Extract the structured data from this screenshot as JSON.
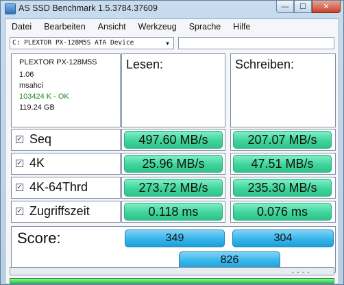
{
  "window": {
    "title": "AS SSD Benchmark 1.5.3784.37609",
    "minimize": "—",
    "maximize": "☐",
    "close": "✕"
  },
  "menu": [
    "Datei",
    "Bearbeiten",
    "Ansicht",
    "Werkzeug",
    "Sprache",
    "Hilfe"
  ],
  "device": {
    "selected": "C: PLEXTOR PX-128M5S ATA Device",
    "arrow": "▼"
  },
  "drive_info": {
    "model": "PLEXTOR PX-128M5S",
    "firmware": "1.06",
    "driver": "msahci",
    "alignment": "103424 K - OK",
    "size": "119.24 GB"
  },
  "headers": {
    "read": "Lesen:",
    "write": "Schreiben:"
  },
  "tests": [
    {
      "label": "Seq",
      "checked": "✓",
      "read": "497.60 MB/s",
      "write": "207.07 MB/s"
    },
    {
      "label": "4K",
      "checked": "✓",
      "read": "25.96 MB/s",
      "write": "47.51 MB/s"
    },
    {
      "label": "4K-64Thrd",
      "checked": "✓",
      "read": "273.72 MB/s",
      "write": "235.30 MB/s"
    },
    {
      "label": "Zugriffszeit",
      "checked": "✓",
      "read": "0.118 ms",
      "write": "0.076 ms"
    }
  ],
  "score": {
    "label": "Score:",
    "read": "349",
    "write": "304",
    "total": "826"
  },
  "status": {
    "progress_text": "- - - -",
    "progress": 1.0
  },
  "colors": {
    "result_pill": "#3fd49b",
    "score_pill": "#36b4ea",
    "ok_text": "#1a8a1a",
    "progress": "#2ccc47"
  }
}
